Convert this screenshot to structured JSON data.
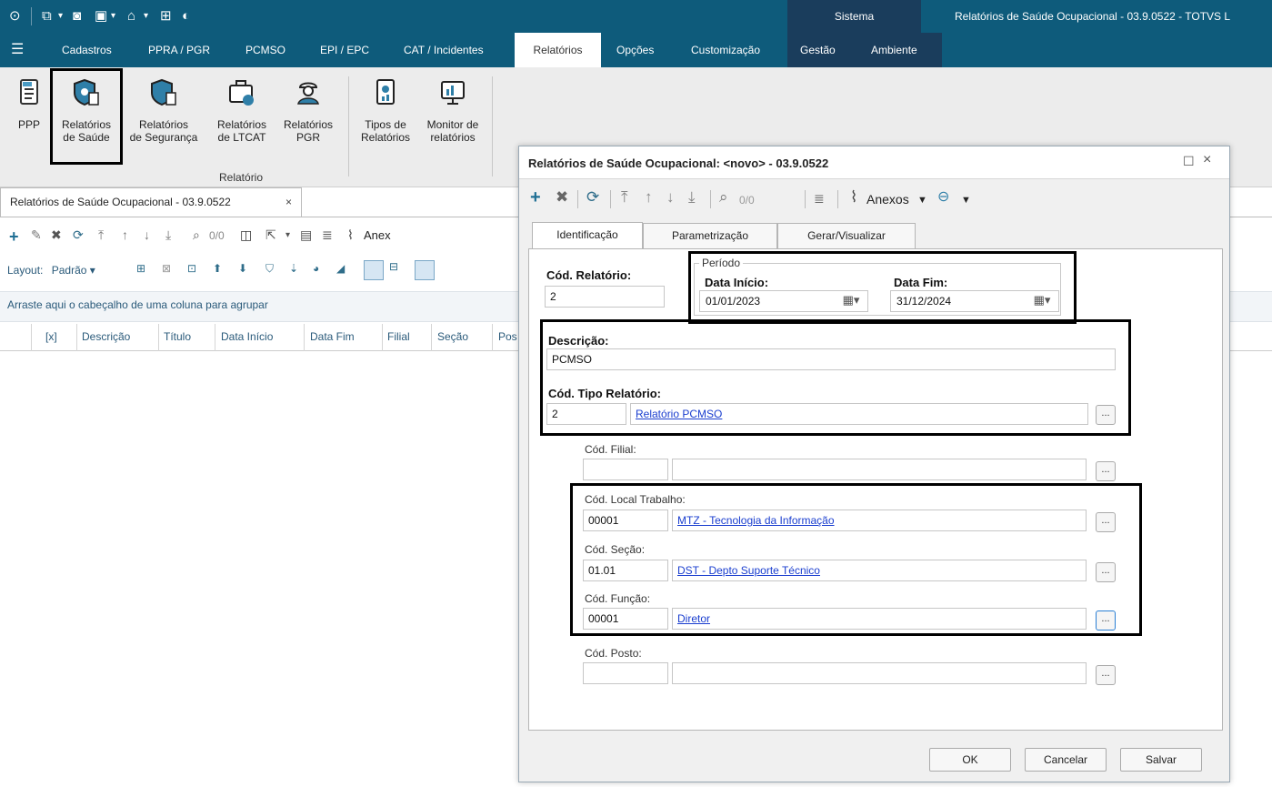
{
  "titlebar": {
    "sistema": "Sistema",
    "app_title": "Relatórios de Saúde Ocupacional - 03.9.0522 - TOTVS L"
  },
  "menu": {
    "items": [
      "Cadastros",
      "PPRA / PGR",
      "PCMSO",
      "EPI / EPC",
      "CAT / Incidentes",
      "Relatórios",
      "Opções",
      "Customização",
      "Gestão",
      "Ambiente"
    ],
    "active": "Relatórios"
  },
  "ribbon": {
    "buttons": [
      {
        "line1": "PPP",
        "line2": ""
      },
      {
        "line1": "Relatórios",
        "line2": "de Saúde"
      },
      {
        "line1": "Relatórios",
        "line2": "de Segurança"
      },
      {
        "line1": "Relatórios",
        "line2": "de LTCAT"
      },
      {
        "line1": "Relatórios",
        "line2": "PGR"
      },
      {
        "line1": "Tipos de",
        "line2": "Relatórios"
      },
      {
        "line1": "Monitor de",
        "line2": "relatórios"
      }
    ],
    "group_label": "Relatório"
  },
  "left_panel": {
    "doc_tab": "Relatórios de Saúde Ocupacional - 03.9.0522",
    "search_count": "0/0",
    "anexos_partial": "Anex",
    "layout_label": "Layout:",
    "layout_value": "Padrão",
    "group_hint": "Arraste aqui o cabeçalho de uma coluna para agrupar",
    "columns": [
      "[x]",
      "Descrição",
      "Título",
      "Data Início",
      "Data Fim",
      "Filial",
      "Seção",
      "Pos"
    ]
  },
  "dialog": {
    "title": "Relatórios de Saúde Ocupacional: <novo> - 03.9.0522",
    "toolbar": {
      "search_count": "0/0",
      "anexos": "Anexos"
    },
    "tabs": [
      "Identificação",
      "Parametrização",
      "Gerar/Visualizar"
    ],
    "active_tab": "Identificação",
    "fields": {
      "cod_relatorio_label": "Cód. Relatório:",
      "cod_relatorio_value": "2",
      "periodo_label": "Período",
      "data_inicio_label": "Data Início:",
      "data_inicio_value": "01/01/2023",
      "data_fim_label": "Data Fim:",
      "data_fim_value": "31/12/2024",
      "descricao_label": "Descrição:",
      "descricao_value": "PCMSO",
      "cod_tipo_label": "Cód. Tipo Relatório:",
      "cod_tipo_value": "2",
      "cod_tipo_desc": "Relatório PCMSO",
      "cod_filial_label": "Cód. Filial:",
      "cod_filial_value": "",
      "cod_filial_desc": "",
      "cod_local_label": "Cód. Local Trabalho:",
      "cod_local_value": "00001",
      "cod_local_desc": "MTZ - Tecnologia da Informação",
      "cod_secao_label": "Cód. Seção:",
      "cod_secao_value": "01.01",
      "cod_secao_desc": "DST - Depto Suporte Técnico",
      "cod_funcao_label": "Cód. Função:",
      "cod_funcao_value": "00001",
      "cod_funcao_desc": "Diretor",
      "cod_posto_label": "Cód. Posto:",
      "cod_posto_value": "",
      "cod_posto_desc": "",
      "lookup_btn": "..."
    },
    "buttons": {
      "ok": "OK",
      "cancel": "Cancelar",
      "save": "Salvar"
    }
  },
  "colors": {
    "brand": "#0e5b7b",
    "brand_dark": "#1a3d5c",
    "link": "#1a3ecf"
  }
}
